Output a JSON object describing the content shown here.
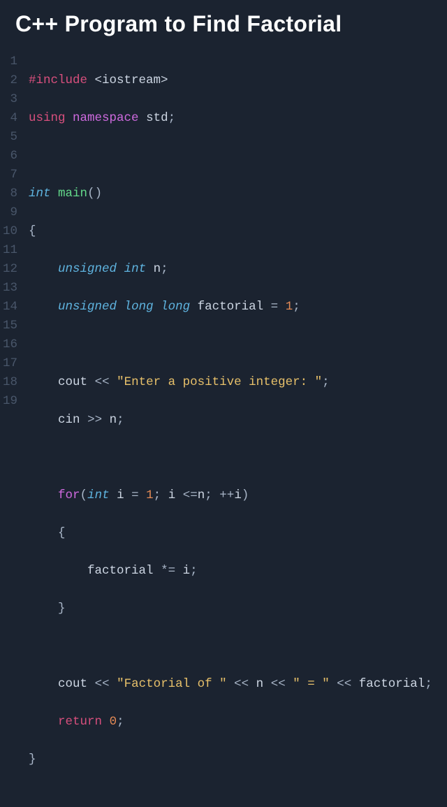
{
  "title": "C++ Program to Find Factorial",
  "lineNumbers": [
    "1",
    "2",
    "3",
    "4",
    "5",
    "6",
    "7",
    "8",
    "9",
    "10",
    "11",
    "12",
    "13",
    "14",
    "15",
    "16",
    "17",
    "18",
    "19"
  ],
  "code": {
    "l1": {
      "include": "#include",
      "header": "<iostream>"
    },
    "l2": {
      "using": "using",
      "namespace": "namespace",
      "std": "std",
      "semi": ";"
    },
    "l4": {
      "int": "int",
      "main": "main",
      "parens": "()"
    },
    "l5": {
      "brace": "{"
    },
    "l6": {
      "unsigned": "unsigned",
      "int": "int",
      "n": "n",
      "semi": ";"
    },
    "l7": {
      "unsigned": "unsigned",
      "long1": "long",
      "long2": "long",
      "id": "factorial",
      "eq": "=",
      "one": "1",
      "semi": ";"
    },
    "l9": {
      "cout": "cout",
      "ops": "<<",
      "str": "\"Enter a positive integer: \"",
      "semi": ";"
    },
    "l10": {
      "cin": "cin",
      "ops": ">>",
      "n": "n",
      "semi": ";"
    },
    "l12": {
      "for": "for",
      "lp": "(",
      "int": "int",
      "i": "i",
      "eq": "=",
      "one": "1",
      "sc1": ";",
      "i2": "i",
      "leq": "<=",
      "n": "n",
      "sc2": ";",
      "pp": "++",
      "i3": "i",
      "rp": ")"
    },
    "l13": {
      "brace": "{"
    },
    "l14": {
      "id": "factorial",
      "op": "*=",
      "i": "i",
      "semi": ";"
    },
    "l15": {
      "brace": "}"
    },
    "l17": {
      "cout": "cout",
      "o1": "<<",
      "s1": "\"Factorial of \"",
      "o2": "<<",
      "n": "n",
      "o3": "<<",
      "s2": "\" = \"",
      "o4": "<<",
      "f": "factorial",
      "semi": ";"
    },
    "l18": {
      "return": "return",
      "zero": "0",
      "semi": ";"
    },
    "l19": {
      "brace": "}"
    }
  }
}
